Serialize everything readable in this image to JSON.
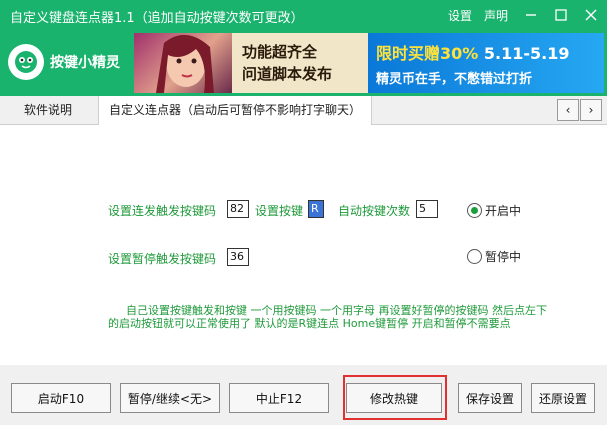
{
  "window": {
    "title": "自定义键盘连点器1.1（追加自动按键次数可更改）",
    "settings_label": "设置",
    "statement_label": "声明"
  },
  "logo": {
    "name": "按键小精灵"
  },
  "banner": {
    "slogan_line1": "功能超齐全",
    "slogan_line2": "问道脚本发布",
    "promo_line1_a": "限时买赠",
    "promo_line1_b": "30%",
    "promo_line1_c": "5.11-5.19",
    "promo_line2": "精灵币在手，不憋错过打折"
  },
  "tabs": [
    {
      "label": "软件说明"
    },
    {
      "label": "自定义连点器（启动后可暂停不影响打字聊天）"
    }
  ],
  "form": {
    "trigger_label": "设置连发触发按键码",
    "trigger_value": "82",
    "key_label": "设置按键",
    "key_value": "R",
    "count_label": "自动按键次数",
    "count_value": "5",
    "pause_label": "设置暂停触发按键码",
    "pause_value": "36"
  },
  "status": {
    "on_label": "开启中",
    "pause_label": "暂停中",
    "selected": "开启中"
  },
  "description": "自己设置按键触发和按键 一个用按键码 一个用字母 再设置好暂停的按键码 然后点左下的启动按钮就可以正常使用了 默认的是R键连点 Home键暂停 开启和暂停不需要点",
  "buttons": {
    "start": "启动F10",
    "pause_continue": "暂停/继续<无>",
    "stop": "中止F12",
    "modify_hotkey": "修改热键",
    "save": "保存设置",
    "restore": "还原设置"
  },
  "colors": {
    "brand_green": "#1ab36e",
    "label_green": "#1e9a3a",
    "highlight_red": "#e03030"
  }
}
